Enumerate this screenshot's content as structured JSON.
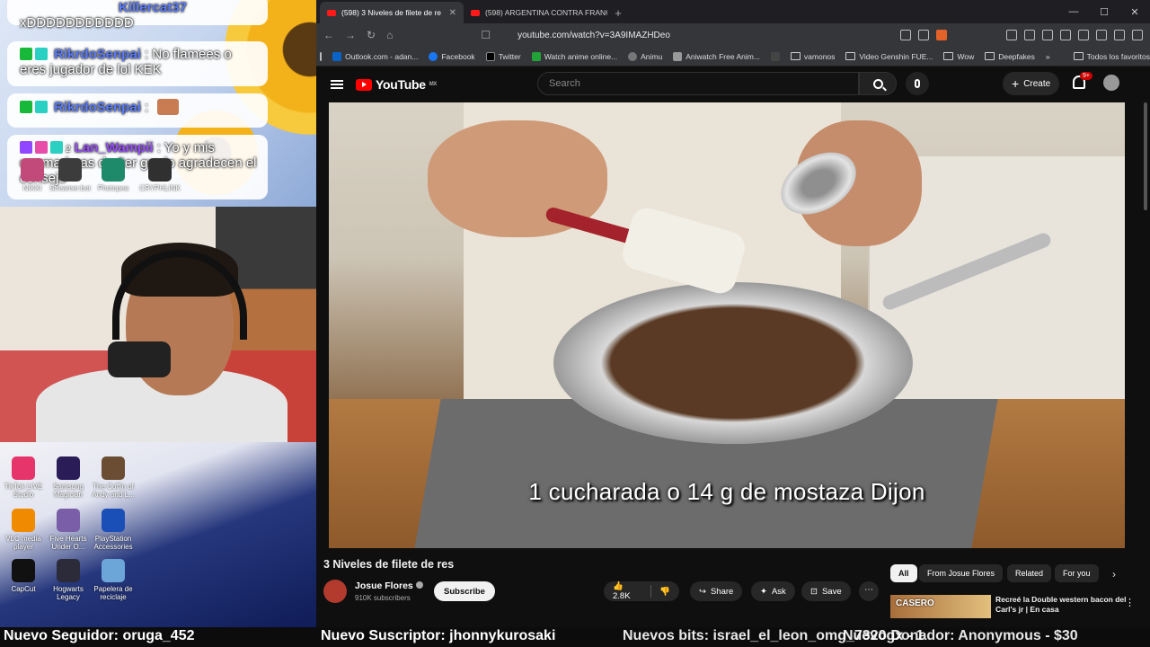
{
  "chat": {
    "top_fragment": {
      "name": "Killercat37",
      "text": "xDDDDDDDDDDD"
    },
    "messages": [
      {
        "name": "RikrdoSenpai",
        "text": "No flamees o eres jugador de lol KEK"
      },
      {
        "name": "RikrdoSenpai",
        "text": ""
      },
      {
        "name": "Lan_Wampii",
        "text": "Yo y mis quemaduras de 3er grado agradecen el consejo"
      }
    ],
    "badge_count": "2"
  },
  "desktop_icons": [
    {
      "label": "NIKKI",
      "color": "#c24a7a"
    },
    {
      "label": "Streamer.bot",
      "color": "#3c3c3c"
    },
    {
      "label": "Photopea",
      "color": "#1f8a6a"
    },
    {
      "label": "CRYPHLINK",
      "color": "#303030"
    },
    {
      "label": "TikTok LIVE Studio",
      "color": "#e6356b"
    },
    {
      "label": "Samsung Magician",
      "color": "#2a1d57"
    },
    {
      "label": "The Coffin of Andy and L...",
      "color": "#6b4d33"
    },
    {
      "label": "VLC media player",
      "color": "#f08a00"
    },
    {
      "label": "Five Hearts Under O...",
      "color": "#7a5ea8"
    },
    {
      "label": "PlayStation Accessories",
      "color": "#1b4fb8"
    },
    {
      "label": "CapCut",
      "color": "#111111"
    },
    {
      "label": "Hogwarts Legacy",
      "color": "#2b2b3a"
    },
    {
      "label": "Papelera de reciclaje",
      "color": "#6ca6d8"
    }
  ],
  "browser": {
    "tabs": [
      {
        "label": "(598) 3 Niveles de filete de re",
        "active": true
      },
      {
        "label": "(598) ARGENTINA CONTRA FRANCIA",
        "active": false
      }
    ],
    "url": "youtube.com/watch?v=3A9IMAZHDeo",
    "bookmarks": [
      {
        "label": "Outlook.com - adan...",
        "color": "#0a64c8"
      },
      {
        "label": "Facebook",
        "color": "#1877f2"
      },
      {
        "label": "Twitter",
        "color": "#000000"
      },
      {
        "label": "Watch anime online...",
        "color": "#21a338"
      },
      {
        "label": "Animu",
        "color": "#777777"
      },
      {
        "label": "Aniwatch Free Anim...",
        "color": "#999999"
      },
      {
        "label": "",
        "color": "#444444"
      },
      {
        "label": "vamonos",
        "color": "folder"
      },
      {
        "label": "Video Genshin FUE...",
        "color": "folder"
      },
      {
        "label": "Wow",
        "color": "folder"
      },
      {
        "label": "Deepfakes",
        "color": "folder"
      }
    ],
    "bookmarks_more": "»",
    "all_bookmarks": "Todos los favoritos"
  },
  "youtube": {
    "logo": "YouTube",
    "region": "MX",
    "search_placeholder": "Search",
    "create_label": "Create",
    "notif_count": "9+",
    "subtitle": "1 cucharada o 14 g de mostaza Dijon",
    "video_title": "3 Niveles de filete de res",
    "channel_name": "Josue Flores",
    "channel_subs": "910K subscribers",
    "subscribe_label": "Subscribe",
    "likes": "2.8K",
    "share_label": "Share",
    "ask_label": "Ask",
    "save_label": "Save",
    "chips": [
      "All",
      "From Josue Flores",
      "Related",
      "For you"
    ],
    "rec": {
      "thumb_text": "CASERO",
      "title": "Recreé la Double western bacon del Carl's jr | En casa"
    }
  },
  "ticker": {
    "follower": "Nuevo Seguidor: oruga_452",
    "subscriber": "Nuevo Suscriptor: jhonnykurosaki",
    "bits": "Nuevos bits: israel_el_leon_omg_7320gx - 1",
    "donation": "Nuevo Donador: Anonymous - $30"
  }
}
